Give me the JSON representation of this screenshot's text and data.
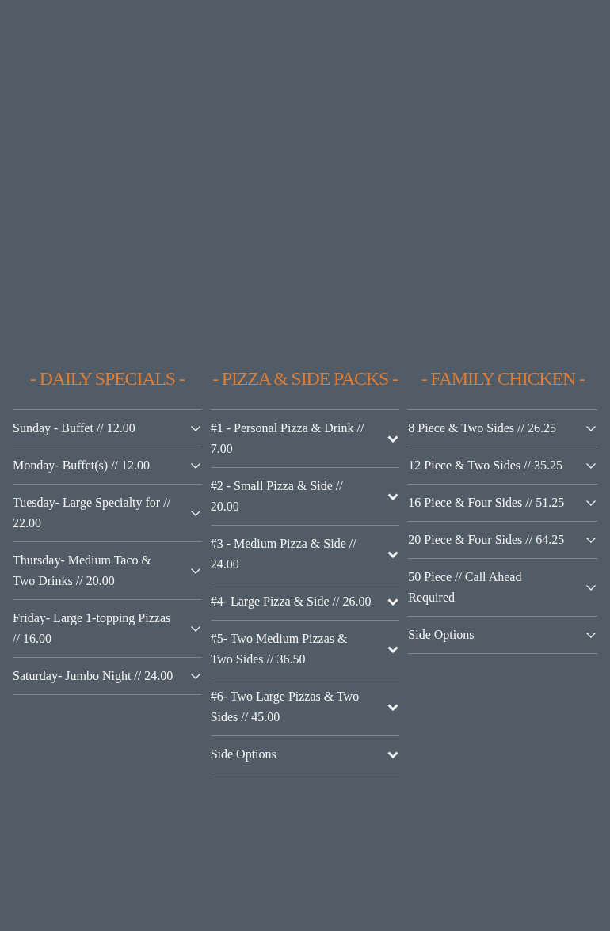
{
  "sections": [
    {
      "heading": "- DAILY SPECIALS -",
      "kind": "thin",
      "items": [
        {
          "label": "Sunday - Buffet // 12.00",
          "expanded": false
        },
        {
          "label": "Monday- Buffet(s) // 12.00",
          "expanded": false
        },
        {
          "label": "Tuesday- Large Specialty for // 22.00",
          "expanded": false
        },
        {
          "label": "Thursday- Medium Taco & Two Drinks // 20.00",
          "expanded": false
        },
        {
          "label": "Friday- Large 1-topping Pizzas // 16.00",
          "expanded": false
        },
        {
          "label": "Saturday- Jumbo Night // 24.00",
          "expanded": false
        }
      ]
    },
    {
      "heading": "- PIZZA & SIDE PACKS -",
      "kind": "bold",
      "items": [
        {
          "label": "#1 - Personal Pizza & Drink // 7.00",
          "expanded": false
        },
        {
          "label": "#2 - Small Pizza & Side // 20.00",
          "expanded": false
        },
        {
          "label": "#3 - Medium Pizza & Side // 24.00",
          "expanded": false
        },
        {
          "label": "#4- Large Pizza & Side // 26.00",
          "expanded": false
        },
        {
          "label": "#5- Two Medium Pizzas & Two Sides // 36.50",
          "expanded": false
        },
        {
          "label": "#6- Two Large Pizzas & Two Sides // 45.00",
          "expanded": false
        },
        {
          "label": "Side Options",
          "expanded": false
        }
      ]
    },
    {
      "heading": "- FAMILY CHICKEN -",
      "kind": "thin",
      "items": [
        {
          "label": "8 Piece & Two Sides // 26.25",
          "expanded": false
        },
        {
          "label": "12 Piece & Two Sides // 35.25",
          "expanded": false
        },
        {
          "label": "16 Piece & Four Sides // 51.25",
          "expanded": false
        },
        {
          "label": "20 Piece & Four Sides // 64.25",
          "expanded": false
        },
        {
          "label": "50 Piece // Call Ahead Required",
          "expanded": false
        },
        {
          "label": "Side Options",
          "expanded": false
        }
      ]
    }
  ]
}
